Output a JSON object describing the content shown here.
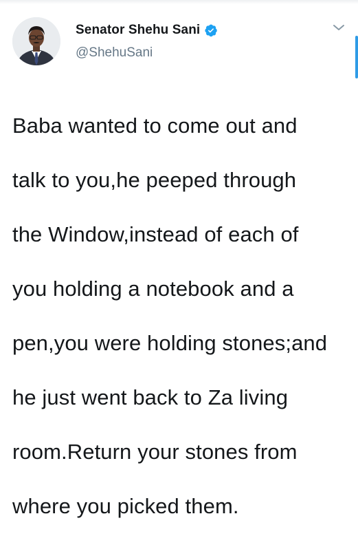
{
  "author": {
    "display_name": "Senator Shehu Sani",
    "handle": "@ShehuSani",
    "verified_icon": "verified-badge-icon",
    "avatar_icon": "profile-photo"
  },
  "tweet": {
    "text_lines": [
      "Baba wanted to come out and",
      "talk to you,he peeped through",
      "the Window,instead of each of",
      "you holding a notebook and a",
      "pen,you were holding stones;and",
      "he just went back to Za living",
      "room.Return your stones from",
      "where you picked them."
    ]
  },
  "menu": {
    "icon": "chevron-down-icon"
  },
  "colors": {
    "text": "#14171a",
    "secondary": "#657786",
    "verified": "#1da1f2",
    "accent_edge": "#2f9be6"
  }
}
